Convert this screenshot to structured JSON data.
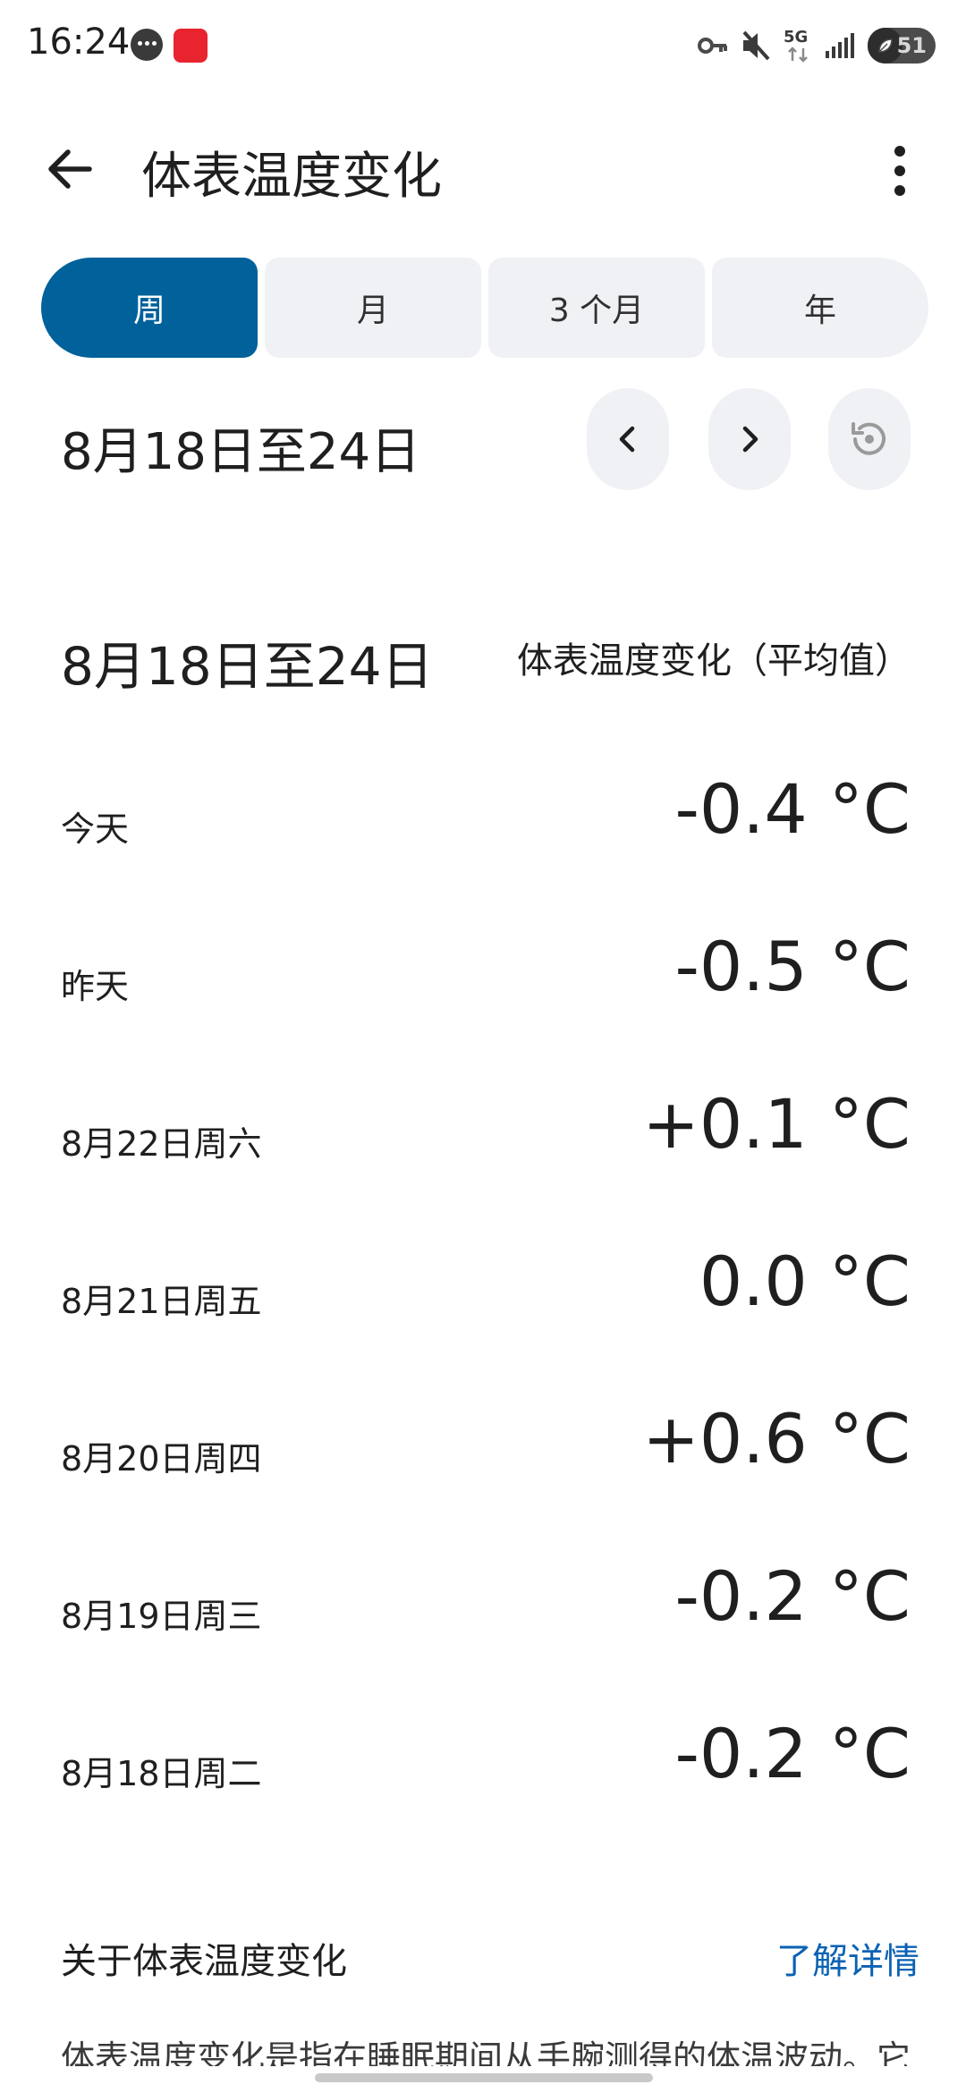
{
  "status_bar": {
    "time": "16:24",
    "network": "5G",
    "battery": "51",
    "battery_level": 0.51
  },
  "app_bar": {
    "title": "体表温度变化"
  },
  "tabs": [
    {
      "label": "周",
      "active": true
    },
    {
      "label": "月",
      "active": false
    },
    {
      "label": "3 个月",
      "active": false
    },
    {
      "label": "年",
      "active": false
    }
  ],
  "date_range": "8月18日至24日",
  "summary": {
    "range": "8月18日至24日",
    "metric": "体表温度变化（平均值）"
  },
  "rows": [
    {
      "label": "今天",
      "value": "-0.4 °C"
    },
    {
      "label": "昨天",
      "value": "-0.5 °C"
    },
    {
      "label": "8月22日周六",
      "value": "+0.1 °C"
    },
    {
      "label": "8月21日周五",
      "value": "0.0 °C"
    },
    {
      "label": "8月20日周四",
      "value": "+0.6 °C"
    },
    {
      "label": "8月19日周三",
      "value": "-0.2 °C"
    },
    {
      "label": "8月18日周二",
      "value": "-0.2 °C"
    }
  ],
  "about": {
    "title": "关于体表温度变化",
    "link": "了解详情",
    "description": "体表温度变化是指在睡眠期间从手腕测得的体温波动。它"
  },
  "colors": {
    "accent": "#00619b",
    "tab_background": "#eff1f5",
    "link": "#0b62b3"
  },
  "icons": {
    "back": "arrow-back-icon",
    "more": "more-vert-icon",
    "prev": "chevron-left-icon",
    "next": "chevron-right-icon",
    "reset": "history-icon"
  }
}
